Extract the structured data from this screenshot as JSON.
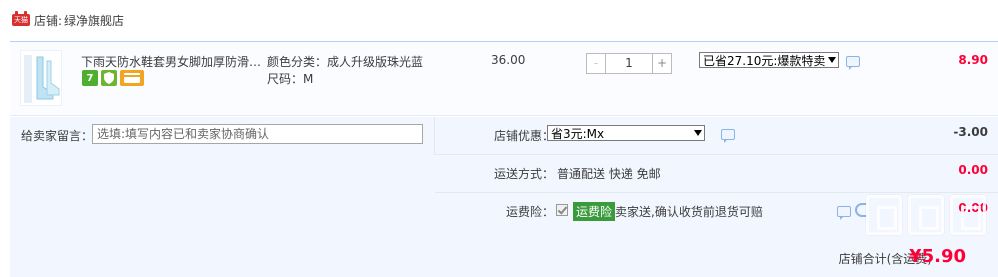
{
  "shop": {
    "badge": "天猫",
    "label": "店铺:",
    "name": "绿净旗舰店"
  },
  "item": {
    "title": "下雨天防水鞋套男女脚加厚防滑…",
    "icons": [
      "seven-day-return-icon",
      "shield-icon",
      "card-icon"
    ],
    "icon_7_text": "7",
    "sku_color": "颜色分类：成人升级版珠光蓝",
    "sku_size": "尺码：M",
    "unit_price": "36.00",
    "quantity": "1",
    "qty_minus": "-",
    "qty_plus": "+",
    "promo_selected": "已省27.10元:爆款特卖",
    "total": "8.90"
  },
  "message": {
    "label": "给卖家留言：",
    "placeholder": "选填:填写内容已和卖家协商确认"
  },
  "shop_discount": {
    "label": "店铺优惠：",
    "selected": "省3元:Mx",
    "amount": "-3.00"
  },
  "shipping": {
    "label": "运送方式：",
    "value": "普通配送 快递 免邮",
    "amount": "0.00"
  },
  "insurance": {
    "label": "运费险：",
    "tag": "运费险",
    "text": "卖家送,确认收货前退货可赔",
    "amount": "0.00"
  },
  "summary": {
    "label": "店铺合计(含运费)",
    "amount": "¥5.90"
  },
  "watermark": {
    "text": "值得买"
  },
  "colors": {
    "accent_red": "#ff0036",
    "panel_blue": "#f2f7ff",
    "border_blue": "#b2d1ff",
    "tag_green": "#3a9b3c"
  }
}
